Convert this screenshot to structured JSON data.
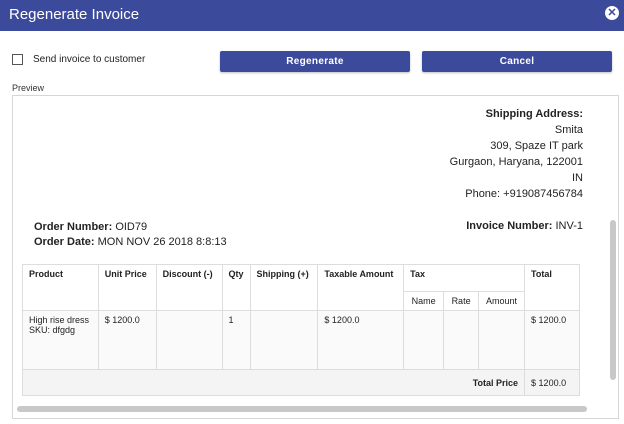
{
  "dialog": {
    "title": "Regenerate Invoice",
    "close_glyph": "✕"
  },
  "options": {
    "send_invoice_label": "Send invoice to customer",
    "send_invoice_checked": false
  },
  "buttons": {
    "regenerate": "Regenerate",
    "cancel": "Cancel"
  },
  "preview": {
    "label": "Preview",
    "shipping": {
      "heading": "Shipping Address:",
      "name": "Smita",
      "line1": "309, Spaze IT park",
      "line2": "Gurgaon, Haryana, 122001",
      "country": "IN",
      "phone": "Phone: +919087456784"
    },
    "order": {
      "number_label": "Order Number:",
      "number": "OID79",
      "date_label": "Order Date:",
      "date": "MON NOV 26 2018 8:8:13",
      "invoice_label": "Invoice Number:",
      "invoice": "INV-1"
    },
    "table": {
      "headers": {
        "product": "Product",
        "unit_price": "Unit Price",
        "discount": "Discount (-)",
        "qty": "Qty",
        "shipping": "Shipping (+)",
        "taxable": "Taxable Amount",
        "tax": "Tax",
        "tax_name": "Name",
        "tax_rate": "Rate",
        "tax_amount": "Amount",
        "total": "Total"
      },
      "row": {
        "product": "High rise dress",
        "sku": "SKU: dfgdg",
        "unit_price": "$ 1200.0",
        "discount": "",
        "qty": "1",
        "shipping": "",
        "taxable": "$ 1200.0",
        "tax_name": "",
        "tax_rate": "",
        "tax_amount": "",
        "total": "$ 1200.0"
      },
      "total_label": "Total Price",
      "total_value": "$ 1200.0"
    }
  }
}
